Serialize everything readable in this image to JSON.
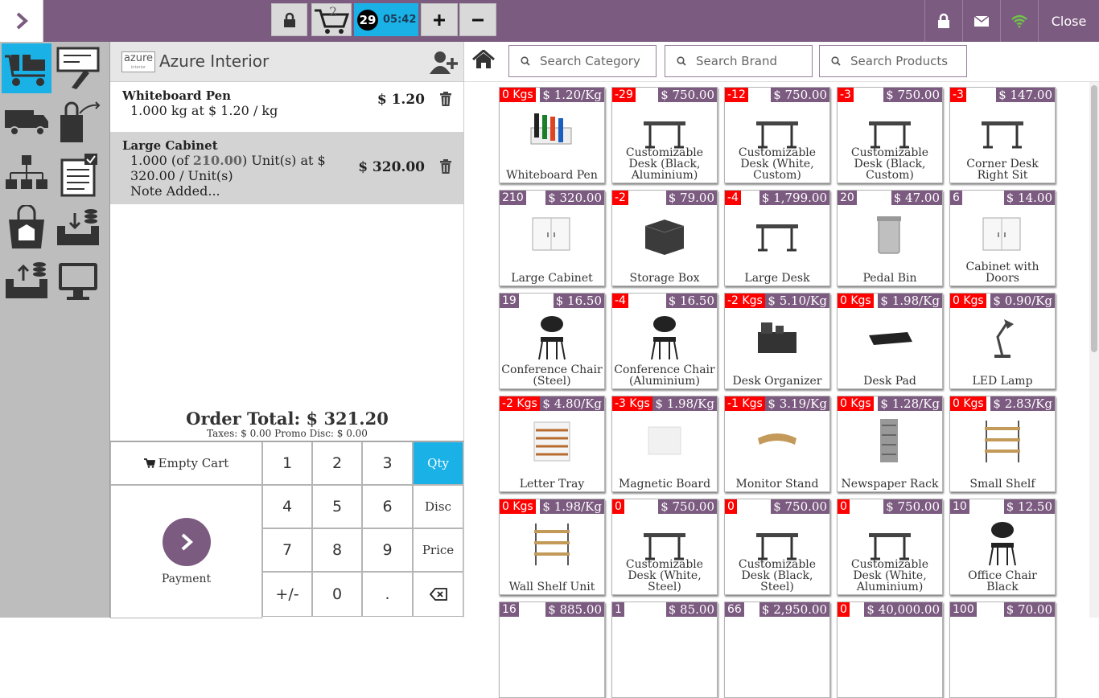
{
  "topbar": {
    "order_count": "29",
    "order_time": "05:42",
    "cart_badge": "2",
    "close_label": "Close",
    "accent_color": "#7c5b80",
    "active_color": "#1ab1e6"
  },
  "company": {
    "logo_text": "azure",
    "logo_sub": "interior",
    "name": "Azure Interior"
  },
  "order_lines": [
    {
      "name": "Whiteboard Pen",
      "detail": "1.000 kg at $ 1.20 / kg",
      "price": "$ 1.20"
    },
    {
      "name": "Large Cabinet",
      "detail_pre": "1.000 (of ",
      "detail_hl": "210.00",
      "detail_post": ") Unit(s) at $",
      "detail_line2": "320.00 / Unit(s)",
      "note": "Note Added...",
      "price": "$ 320.00"
    }
  ],
  "totals": {
    "order_total": "Order Total: $ 321.20",
    "sub": "Taxes: $ 0.00   Promo Disc: $ 0.00"
  },
  "numpad": {
    "empty_cart": "Empty Cart",
    "payment": "Payment",
    "keys": [
      "1",
      "2",
      "3",
      "4",
      "5",
      "6",
      "7",
      "8",
      "9",
      "+/-",
      "0",
      "."
    ],
    "qty": "Qty",
    "disc": "Disc",
    "price": "Price"
  },
  "search": {
    "category": "Search Category",
    "brand": "Search Brand",
    "products": "Search Products"
  },
  "products": [
    {
      "name": "Whiteboard Pen",
      "qty": "0 Kgs",
      "price": "$ 1.20/Kg",
      "neg": true,
      "icon": "pens-image"
    },
    {
      "name": "Customizable Desk (Black, Aluminium)",
      "qty": "-29",
      "price": "$ 750.00",
      "neg": true,
      "icon": "desk-image"
    },
    {
      "name": "Customizable Desk (White, Custom)",
      "qty": "-12",
      "price": "$ 750.00",
      "neg": true,
      "icon": "desk-image"
    },
    {
      "name": "Customizable Desk (Black, Custom)",
      "qty": "-3",
      "price": "$ 750.00",
      "neg": true,
      "icon": "desk-image"
    },
    {
      "name": "Corner Desk Right Sit",
      "qty": "-3",
      "price": "$ 147.00",
      "neg": true,
      "icon": "desk-image"
    },
    {
      "name": "Large Cabinet",
      "qty": "210",
      "price": "$ 320.00",
      "neg": false,
      "icon": "cabinet-image"
    },
    {
      "name": "Storage Box",
      "qty": "-2",
      "price": "$ 79.00",
      "neg": true,
      "icon": "box-image"
    },
    {
      "name": "Large Desk",
      "qty": "-4",
      "price": "$ 1,799.00",
      "neg": true,
      "icon": "desk-image"
    },
    {
      "name": "Pedal Bin",
      "qty": "20",
      "price": "$ 47.00",
      "neg": false,
      "icon": "bin-image"
    },
    {
      "name": "Cabinet with Doors",
      "qty": "6",
      "price": "$ 14.00",
      "neg": false,
      "icon": "cabinet-image"
    },
    {
      "name": "Conference Chair (Steel)",
      "qty": "19",
      "price": "$ 16.50",
      "neg": false,
      "icon": "chair-image"
    },
    {
      "name": "Conference Chair (Aluminium)",
      "qty": "-4",
      "price": "$ 16.50",
      "neg": true,
      "icon": "chair-image"
    },
    {
      "name": "Desk Organizer",
      "qty": "-2 Kgs",
      "price": "$ 5.10/Kg",
      "neg": true,
      "icon": "organizer-image"
    },
    {
      "name": "Desk Pad",
      "qty": "0 Kgs",
      "price": "$ 1.98/Kg",
      "neg": true,
      "icon": "pad-image"
    },
    {
      "name": "LED Lamp",
      "qty": "0 Kgs",
      "price": "$ 0.90/Kg",
      "neg": true,
      "icon": "lamp-image"
    },
    {
      "name": "Letter Tray",
      "qty": "-2 Kgs",
      "price": "$ 4.80/Kg",
      "neg": true,
      "icon": "tray-image"
    },
    {
      "name": "Magnetic Board",
      "qty": "-3 Kgs",
      "price": "$ 1.98/Kg",
      "neg": true,
      "icon": "board-image"
    },
    {
      "name": "Monitor Stand",
      "qty": "-1 Kgs",
      "price": "$ 3.19/Kg",
      "neg": true,
      "icon": "stand-image"
    },
    {
      "name": "Newspaper Rack",
      "qty": "0 Kgs",
      "price": "$ 1.28/Kg",
      "neg": true,
      "icon": "rack-image"
    },
    {
      "name": "Small Shelf",
      "qty": "0 Kgs",
      "price": "$ 2.83/Kg",
      "neg": true,
      "icon": "shelf-image"
    },
    {
      "name": "Wall Shelf Unit",
      "qty": "0 Kgs",
      "price": "$ 1.98/Kg",
      "neg": true,
      "icon": "shelf-image"
    },
    {
      "name": "Customizable Desk (White, Steel)",
      "qty": "0",
      "price": "$ 750.00",
      "neg": true,
      "icon": "desk-image"
    },
    {
      "name": "Customizable Desk (Black, Steel)",
      "qty": "0",
      "price": "$ 750.00",
      "neg": true,
      "icon": "desk-image"
    },
    {
      "name": "Customizable Desk (White, Aluminium)",
      "qty": "0",
      "price": "$ 750.00",
      "neg": true,
      "icon": "desk-image"
    },
    {
      "name": "Office Chair Black",
      "qty": "10",
      "price": "$ 12.50",
      "neg": false,
      "icon": "chair-image"
    },
    {
      "name": "",
      "qty": "16",
      "price": "$ 885.00",
      "neg": false,
      "icon": ""
    },
    {
      "name": "",
      "qty": "1",
      "price": "$ 85.00",
      "neg": false,
      "icon": ""
    },
    {
      "name": "",
      "qty": "66",
      "price": "$ 2,950.00",
      "neg": false,
      "icon": ""
    },
    {
      "name": "",
      "qty": "0",
      "price": "$ 40,000.00",
      "neg": true,
      "icon": ""
    },
    {
      "name": "",
      "qty": "100",
      "price": "$ 70.00",
      "neg": false,
      "icon": ""
    }
  ]
}
